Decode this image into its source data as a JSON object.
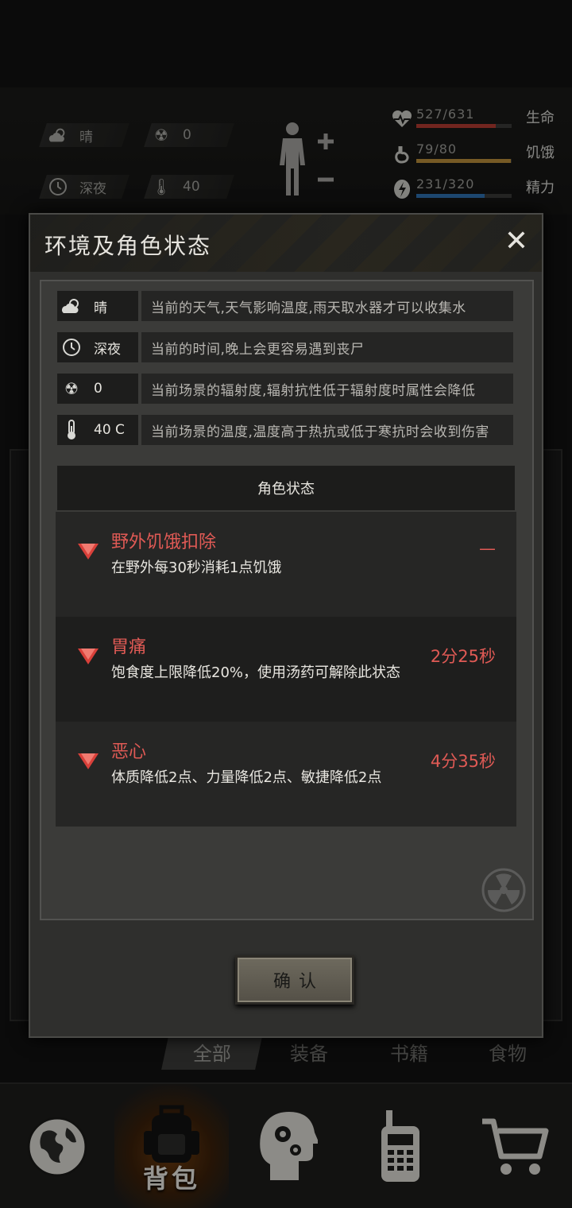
{
  "hud": {
    "weather": {
      "icon": "partly-cloudy-icon",
      "value": "晴"
    },
    "radiation": {
      "icon": "radiation-icon",
      "value": "0"
    },
    "time": {
      "icon": "clock-icon",
      "value": "深夜"
    },
    "temperature": {
      "icon": "thermometer-icon",
      "value": "40"
    },
    "stats": [
      {
        "name": "生命",
        "value": "527/631",
        "fraction": 0.835,
        "color": "#b03a30",
        "icon": "heart-icon"
      },
      {
        "name": "饥饿",
        "value": "79/80",
        "fraction": 0.9875,
        "color": "#b58a3a",
        "icon": "stomach-icon"
      },
      {
        "name": "精力",
        "value": "231/320",
        "fraction": 0.72,
        "color": "#2e6fb0",
        "icon": "energy-icon"
      }
    ]
  },
  "modal": {
    "title": "环境及角色状态",
    "close_label": "✕",
    "environment": [
      {
        "icon": "partly-cloudy-icon",
        "label": "晴",
        "desc": "当前的天气,天气影响温度,雨天取水器才可以收集水"
      },
      {
        "icon": "clock-icon",
        "label": "深夜",
        "desc": "当前的时间,晚上会更容易遇到丧尸"
      },
      {
        "icon": "radiation-icon",
        "label": "0",
        "desc": "当前场景的辐射度,辐射抗性低于辐射度时属性会降低"
      },
      {
        "icon": "thermometer-icon",
        "label": "40 C",
        "desc": "当前场景的温度,温度高于热抗或低于寒抗时会收到伤害"
      }
    ],
    "status_header": "角色状态",
    "statuses": [
      {
        "name": "野外饥饿扣除",
        "desc": "在野外每30秒消耗1点饥饿",
        "time": "—"
      },
      {
        "name": "胃痛",
        "desc": "饱食度上限降低20%，使用汤药可解除此状态",
        "time": "2分25秒"
      },
      {
        "name": "恶心",
        "desc": "体质降低2点、力量降低2点、敏捷降低2点",
        "time": "4分35秒"
      }
    ],
    "confirm_label": "确认"
  },
  "category_tabs": [
    "全部",
    "装备",
    "书籍",
    "食物"
  ],
  "bottom_nav": [
    {
      "icon": "globe-icon",
      "label": ""
    },
    {
      "icon": "backpack-icon",
      "label": "背包"
    },
    {
      "icon": "head-gears-icon",
      "label": ""
    },
    {
      "icon": "walkie-talkie-icon",
      "label": ""
    },
    {
      "icon": "shopping-cart-icon",
      "label": ""
    }
  ]
}
